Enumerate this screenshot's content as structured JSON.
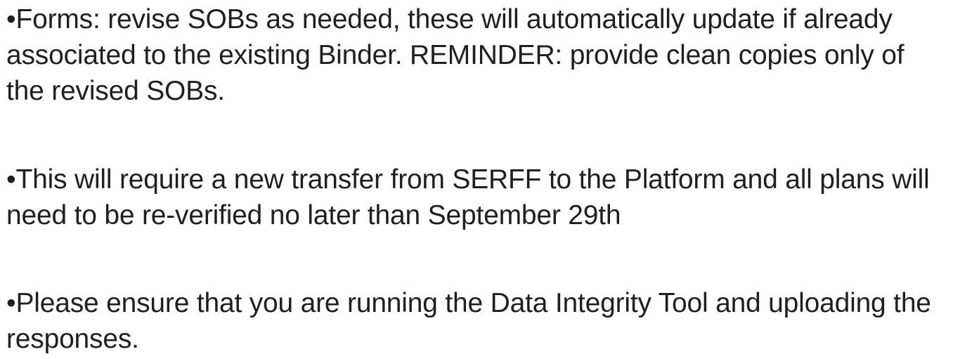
{
  "bullets": [
    {
      "marker": "•",
      "text": "Forms:  revise SOBs as needed, these will automatically update if already associated to the existing Binder.  REMINDER:  provide clean copies only of the revised SOBs."
    },
    {
      "marker": "•",
      "text": "This will require a new transfer from SERFF to the Platform and all plans will need to be re-verified no later than September 29th"
    },
    {
      "marker": "•",
      "text": "Please ensure that you are running the Data Integrity Tool and uploading the responses."
    }
  ]
}
